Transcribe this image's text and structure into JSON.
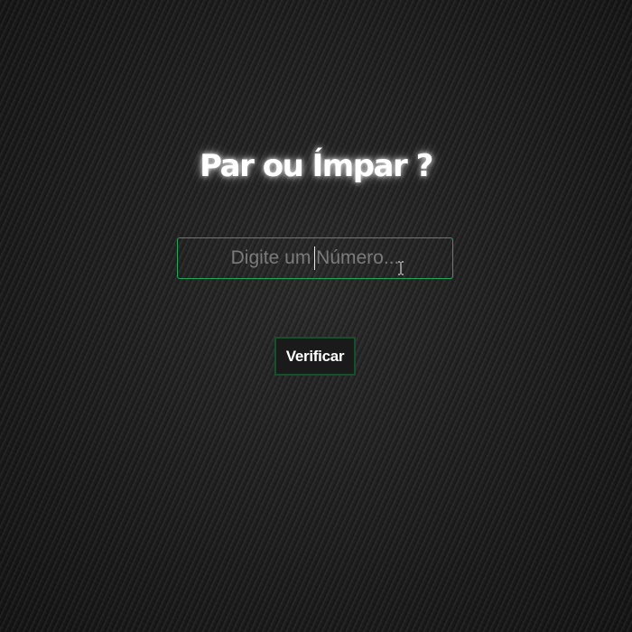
{
  "header": {
    "title": "Par ou Ímpar ?"
  },
  "form": {
    "number_input": {
      "value": "",
      "placeholder": "Digite um Número..."
    },
    "verify_button_label": "Verificar"
  },
  "colors": {
    "accent_border": "#21a55a",
    "button_border": "#15502d",
    "background": "#1f1f1f"
  },
  "icons": {
    "pointer": "ibeam-cursor-icon"
  }
}
